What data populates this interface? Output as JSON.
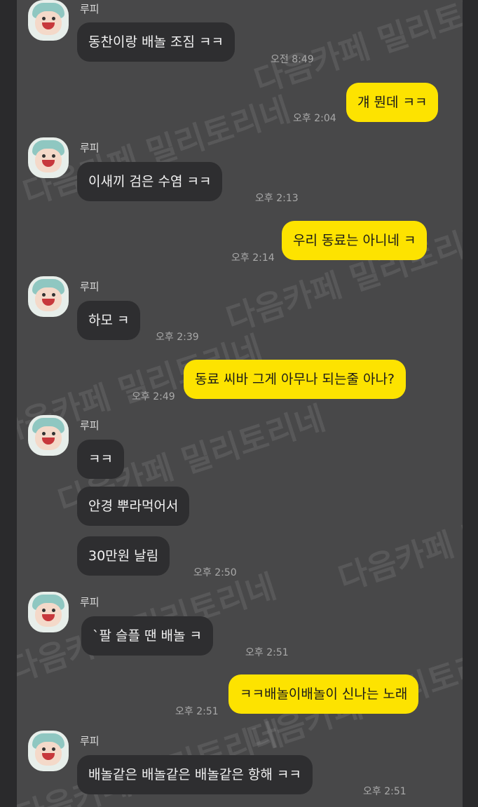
{
  "sender_name": "루피",
  "watermark": "다음카페 밀리토리네",
  "messages": [
    {
      "text": "동찬이랑 배놀 조짐 ㅋㅋ",
      "time": "오전 8:49"
    },
    {
      "text": "걔 뭔데 ㅋㅋ",
      "time": "오후 2:04"
    },
    {
      "text": "이새끼 검은 수염 ㅋㅋ",
      "time": "오후 2:13"
    },
    {
      "text": "우리 동료는 아니네 ㅋ",
      "time": "오후 2:14"
    },
    {
      "text": "하모 ㅋ",
      "time": "오후 2:39"
    },
    {
      "text": "동료 씨바 그게 아무나 되는줄 아나?",
      "time": "오후 2:49"
    },
    {
      "text": "ㅋㅋ"
    },
    {
      "text": "안경 뿌라먹어서"
    },
    {
      "text": "30만원 날림",
      "time": "오후 2:50"
    },
    {
      "text": "`팔 슬플 땐 배놀 ㅋ",
      "time": "오후 2:51"
    },
    {
      "text": "ㅋㅋ배놀이배놀이 신나는 노래",
      "time": "오후 2:51"
    },
    {
      "text": "배놀같은 배놀같은 배놀같은 항해 ㅋㅋ",
      "time": "오후 2:51"
    }
  ]
}
